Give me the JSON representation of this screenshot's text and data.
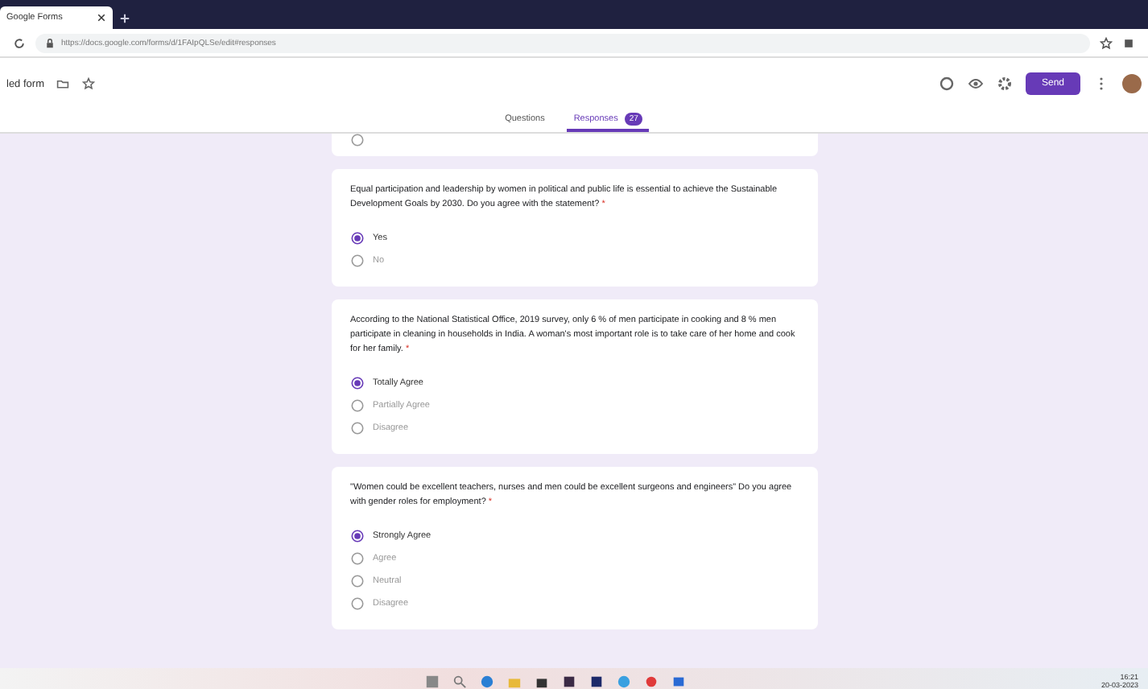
{
  "browser": {
    "tab_title": "Google Forms",
    "url": "https://docs.google.com/forms/d/1FAIpQLSe/edit#responses"
  },
  "header": {
    "form_title": "led form",
    "send_label": "Send"
  },
  "tabs": [
    {
      "label": "Questions",
      "selected": false
    },
    {
      "label": "Responses",
      "selected": true,
      "badge": "27"
    }
  ],
  "previous_option": {
    "selected": false
  },
  "questions": [
    {
      "text": "Equal participation and leadership by women in political and public life is essential to achieve the Sustainable Development Goals by 2030. Do you agree with the statement?",
      "required_mark": "*",
      "options": [
        {
          "label": "Yes",
          "selected": true
        },
        {
          "label": "No",
          "selected": false
        }
      ]
    },
    {
      "text": "According to the National Statistical Office, 2019 survey, only 6 % of men participate in cooking and 8 % men participate in cleaning in households in India. A woman's most important role is to take care of her home and cook for her family.",
      "required_mark": "*",
      "options": [
        {
          "label": "Totally Agree",
          "selected": true
        },
        {
          "label": "Partially Agree",
          "selected": false
        },
        {
          "label": "Disagree",
          "selected": false
        }
      ]
    },
    {
      "text": "\"Women could be excellent teachers, nurses and men could be excellent surgeons and engineers\" Do you agree with gender roles for employment?",
      "required_mark": "*",
      "options": [
        {
          "label": "Strongly Agree",
          "selected": true
        },
        {
          "label": "Agree",
          "selected": false
        },
        {
          "label": "Neutral",
          "selected": false
        },
        {
          "label": "Disagree",
          "selected": false
        }
      ]
    }
  ],
  "taskbar": {
    "time": "16:21",
    "date": "20-03-2023"
  }
}
